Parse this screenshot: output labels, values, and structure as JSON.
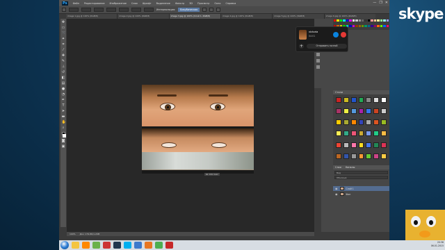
{
  "app": {
    "logo": "Ps",
    "menu": [
      "Файл",
      "Редактирование",
      "Изображение",
      "Слои",
      "Шрифт",
      "Выделение",
      "Фильтр",
      "3D",
      "Просмотр",
      "Окно",
      "Справка"
    ],
    "window_controls": [
      "—",
      "❐",
      "✕"
    ]
  },
  "options": {
    "mode_label": "Интерполяция:",
    "mode_button": "Бикубическая"
  },
  "tabs": [
    {
      "label": "image 1.jpg @ 100% (RGB/8)",
      "active": false
    },
    {
      "label": "image 2.jpg @ 100% (RGB/8)",
      "active": false
    },
    {
      "label": "image 3.jpg @ 100% (Слой 1, RGB/8)",
      "active": true
    },
    {
      "label": "image 4.jpg @ 100% (RGB/8)",
      "active": false
    },
    {
      "label": "image 5.jpg @ 100% (RGB/8)",
      "active": false
    },
    {
      "label": "image 6.jpg @ 100% (RGB/8)",
      "active": false
    }
  ],
  "canvas": {
    "transform_tip": "Ш: 161 пикс"
  },
  "status": {
    "zoom": "100%",
    "doc": "Док: 179,8K/1,29M"
  },
  "panels": {
    "styles_title": "Стили",
    "layers_tabs": [
      "Слои",
      "Каналы"
    ],
    "layers_filter": "Вид",
    "layers_mode": "Обычные",
    "layers": [
      {
        "name": "Слой 1",
        "selected": true
      },
      {
        "name": "Фон",
        "selected": false
      }
    ],
    "color_swatches": [
      "#ff0000",
      "#ffff00",
      "#00ff00",
      "#00ffff",
      "#0000ff",
      "#ff00ff",
      "#ffffff",
      "#cccccc",
      "#999999",
      "#666666",
      "#333333",
      "#000000",
      "#ff9999",
      "#ffcc99",
      "#ffff99",
      "#99ff99",
      "#99ffff",
      "#9999ff",
      "#cc0000",
      "#cc6600",
      "#cccc00",
      "#00cc00",
      "#00cccc",
      "#0000cc",
      "#cc00cc",
      "#993300",
      "#996600",
      "#669900",
      "#009966",
      "#006699",
      "#330099",
      "#990066",
      "#ff6600",
      "#66ff00",
      "#0066ff",
      "#ff0066"
    ],
    "style_swatches": [
      "#cc2222",
      "#ccbb22",
      "#2255cc",
      "#22aa55",
      "#888888",
      "#dddddd",
      "#ffffff",
      "#aa3366",
      "#eeee44",
      "#5599dd",
      "#aa22aa",
      "#3377ee",
      "#cc4422",
      "#cccccc",
      "#ffcc00",
      "#aaaa33",
      "#ff8800",
      "#3344bb",
      "#aaaaaa",
      "#dd5522",
      "#99bb22",
      "#ffee55",
      "#33aa88",
      "#ee5577",
      "#ccaa33",
      "#7799ee",
      "#22cc88",
      "#ffbb44",
      "#ee4433",
      "#bbbbbb",
      "#ff77aa",
      "#ffdd22",
      "#4477ee",
      "#228855",
      "#dd3355",
      "#bb6622",
      "#3355aa",
      "#999999",
      "#ff9933",
      "#66cc33",
      "#cc4488",
      "#ffcc44"
    ]
  },
  "skype_call": {
    "name": "victoria",
    "time": "04:01",
    "message_button": "Отправить почтой",
    "plus_label": "+"
  },
  "skype_logo": "skype",
  "tray": {
    "time": "20:36",
    "date": "06.01.2015"
  },
  "colors": {
    "accent": "#31a8ff",
    "call": "#0a84e0",
    "end_call": "#e53935"
  }
}
